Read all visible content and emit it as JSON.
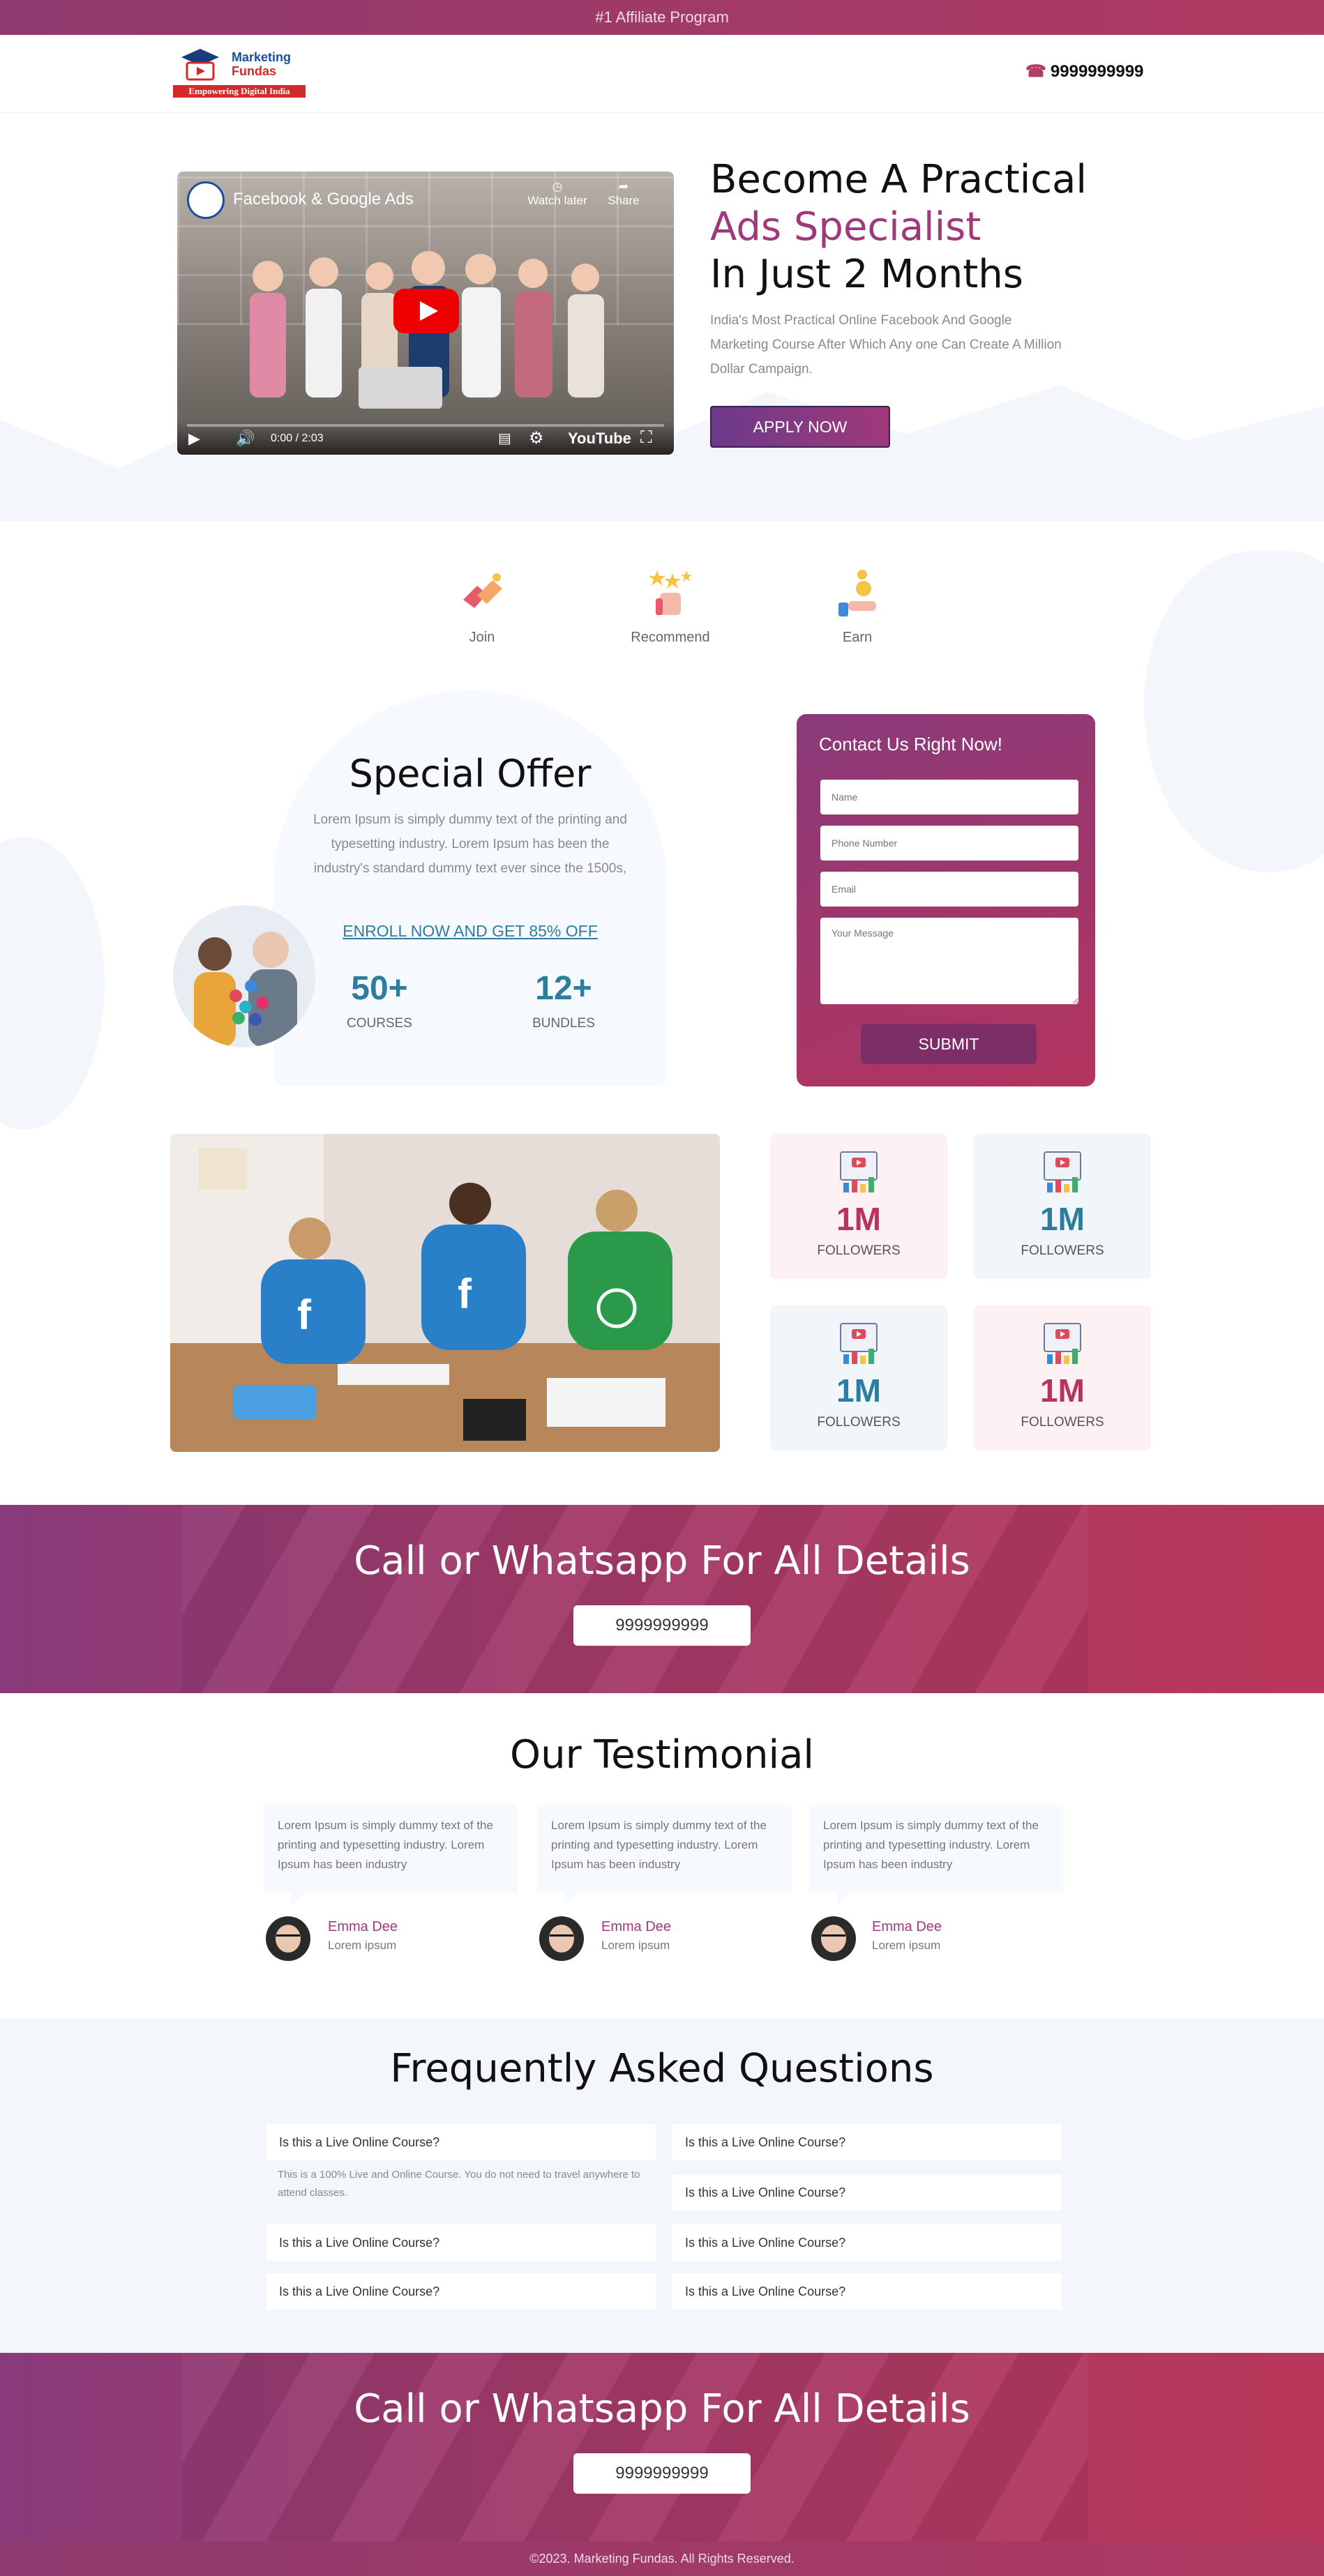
{
  "topbar": {
    "text": "#1 Affiliate Program"
  },
  "header": {
    "logo_line1": "Marketing",
    "logo_line2": "Fundas",
    "logo_tagline": "Empowering Digital India",
    "phone": "9999999999"
  },
  "hero": {
    "video_title": "Facebook & Google Ads",
    "watch_later": "Watch later",
    "share": "Share",
    "time": "0:00 / 2:03",
    "youtube": "YouTube",
    "heading_line1": "Become A Practical",
    "heading_line2": "Ads Specialist",
    "heading_line3": "In Just 2 Months",
    "subtitle": "India's Most Practical Online Facebook And Google Marketing Course After Which Any one Can Create A Million Dollar Campaign.",
    "apply_label": "APPLY NOW"
  },
  "steps": [
    {
      "label": "Join",
      "icon": "handshake-icon"
    },
    {
      "label": "Recommend",
      "icon": "stars-hand-icon"
    },
    {
      "label": "Earn",
      "icon": "coin-hand-icon"
    }
  ],
  "offer": {
    "title": "Special Offer",
    "text": "Lorem Ipsum is simply dummy text of the printing and typesetting industry. Lorem Ipsum has been the industry's standard dummy text ever since the 1500s,",
    "link": "ENROLL NOW AND GET 85% OFF",
    "stats": [
      {
        "number": "50+",
        "label": "COURSES"
      },
      {
        "number": "12+",
        "label": "BUNDLES"
      }
    ]
  },
  "contact": {
    "title": "Contact Us Right Now!",
    "name_placeholder": "Name",
    "phone_placeholder": "Phone Number",
    "email_placeholder": "Email",
    "message_placeholder": "Your Message",
    "submit_label": "SUBMIT"
  },
  "followers": [
    {
      "number": "1M",
      "label": "FOLLOWERS"
    },
    {
      "number": "1M",
      "label": "FOLLOWERS"
    },
    {
      "number": "1M",
      "label": "FOLLOWERS"
    },
    {
      "number": "1M",
      "label": "FOLLOWERS"
    }
  ],
  "cta": {
    "heading": "Call or Whatsapp For All Details",
    "phone": "9999999999"
  },
  "testimonial": {
    "heading": "Our Testimonial",
    "items": [
      {
        "quote": "Lorem Ipsum is simply dummy text of the printing and typesetting industry. Lorem Ipsum has been industry",
        "name": "Emma Dee",
        "role": "Lorem ipsum"
      },
      {
        "quote": "Lorem Ipsum is simply dummy text of the printing and typesetting industry. Lorem Ipsum has been industry",
        "name": "Emma Dee",
        "role": "Lorem ipsum"
      },
      {
        "quote": "Lorem Ipsum is simply dummy text of the printing and typesetting industry. Lorem Ipsum has been industry",
        "name": "Emma Dee",
        "role": "Lorem ipsum"
      }
    ]
  },
  "faq": {
    "heading": "Frequently Asked Questions",
    "left": [
      "Is this a Live Online Course?",
      "Is this a Live Online Course?",
      "Is this a Live Online Course?"
    ],
    "right": [
      "Is this a Live Online Course?",
      "Is this a Live Online Course?",
      "Is this a Live Online Course?",
      "Is this a Live Online Course?"
    ],
    "answer": "This is a 100% Live and Online Course. You do not need to travel anywhere to attend classes."
  },
  "cta2": {
    "heading": "Call or Whatsapp For All Details",
    "phone": "9999999999"
  },
  "footer": {
    "text": "©2023. Marketing Fundas. All Rights Reserved."
  }
}
